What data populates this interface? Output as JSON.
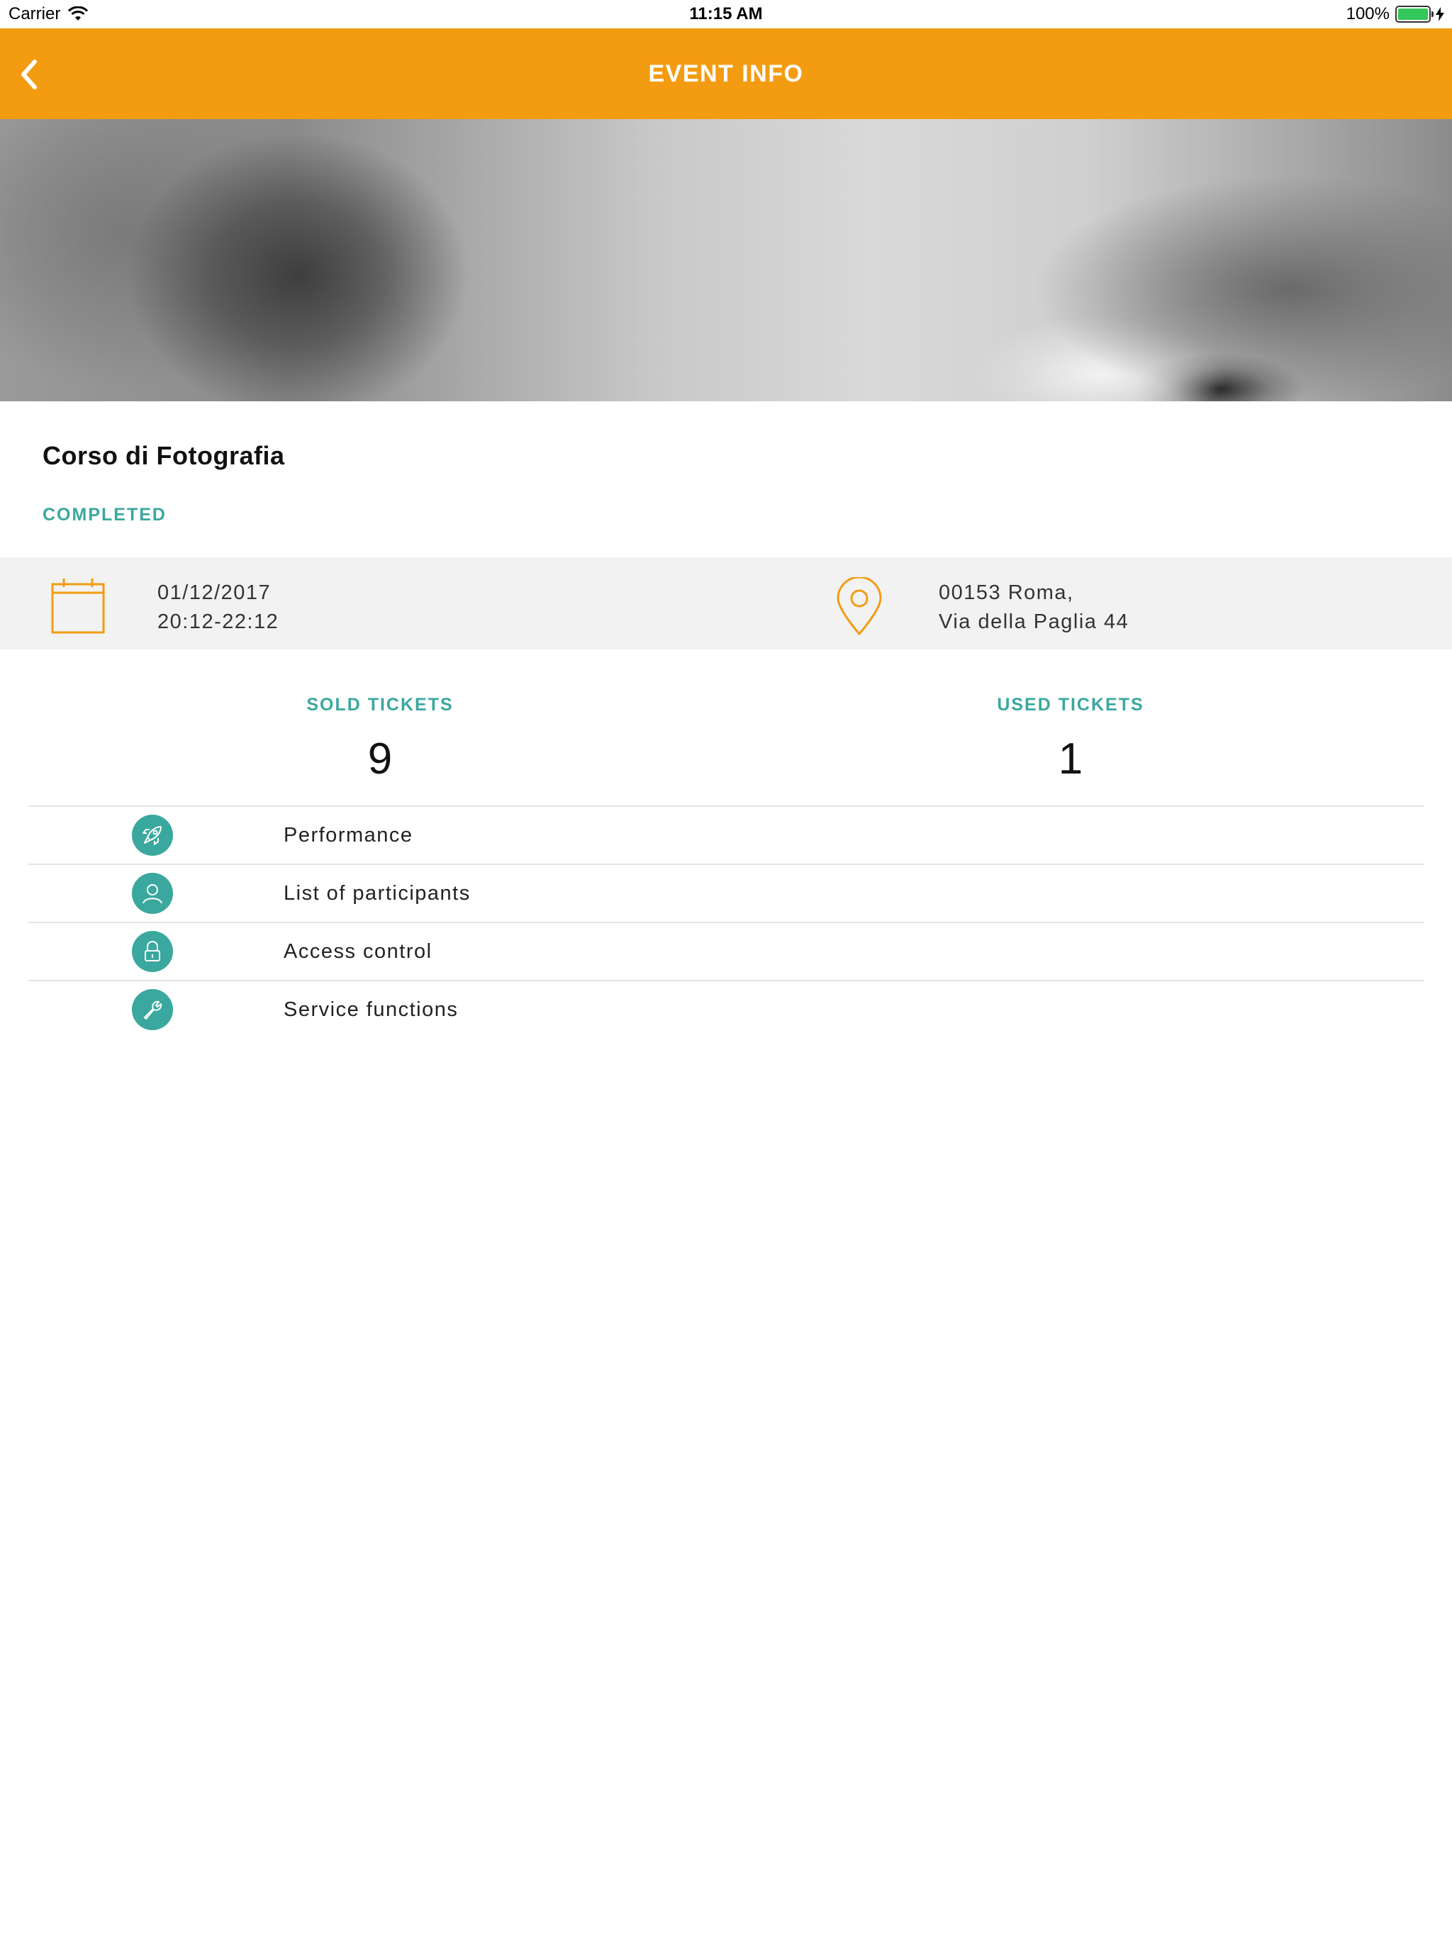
{
  "status_bar": {
    "carrier": "Carrier",
    "time": "11:15 AM",
    "battery": "100%",
    "battery_level": 1.0
  },
  "nav": {
    "title": "EVENT INFO",
    "back_icon": "chevron-left-icon"
  },
  "colors": {
    "accent": "#f39c12",
    "teal": "#3aa89e",
    "band_bg": "#f2f2f2"
  },
  "event": {
    "name": "Corso di Fotografia",
    "status": "COMPLETED",
    "date": "01/12/2017",
    "time_range": "20:12-22:12",
    "address_line1": "00153 Roma,",
    "address_line2": "Via della Paglia 44"
  },
  "tickets": {
    "sold_label": "SOLD TICKETS",
    "sold_value": "9",
    "used_label": "USED TICKETS",
    "used_value": "1"
  },
  "menu": [
    {
      "label": "Performance",
      "icon": "rocket-icon"
    },
    {
      "label": "List of participants",
      "icon": "person-icon"
    },
    {
      "label": "Access control",
      "icon": "lock-icon"
    },
    {
      "label": "Service functions",
      "icon": "wrench-icon"
    }
  ]
}
